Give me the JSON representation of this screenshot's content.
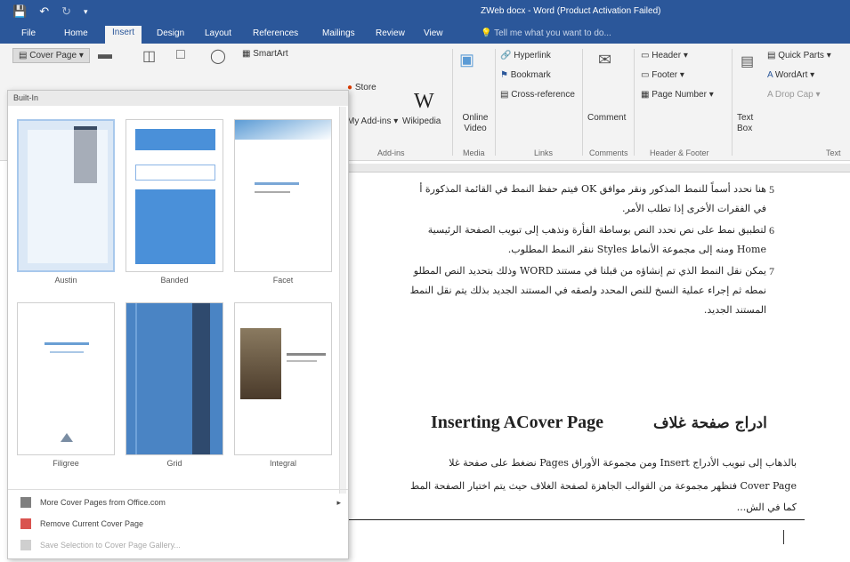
{
  "window": {
    "title": "ZWeb docx - Word (Product Activation Failed)"
  },
  "tabs": [
    {
      "label": "File"
    },
    {
      "label": "Home"
    },
    {
      "label": "Insert"
    },
    {
      "label": "Design"
    },
    {
      "label": "Layout"
    },
    {
      "label": "References"
    },
    {
      "label": "Mailings"
    },
    {
      "label": "Review"
    },
    {
      "label": "View"
    }
  ],
  "tell_me": {
    "placeholder": "Tell me what you want to do..."
  },
  "ribbon": {
    "cover_page": "Cover Page",
    "smartart": "SmartArt",
    "store": "Store",
    "my_addins": "My Add-ins",
    "wikipedia": "Wikipedia",
    "online_video": "Online Video",
    "hyperlink": "Hyperlink",
    "bookmark": "Bookmark",
    "cross_reference": "Cross-reference",
    "comment": "Comment",
    "header": "Header",
    "footer": "Footer",
    "page_number": "Page Number",
    "text_box": "Text Box",
    "quick_parts": "Quick Parts",
    "wordart": "WordArt",
    "drop_cap": "Drop Cap",
    "groups": {
      "addins": "Add-ins",
      "media": "Media",
      "links": "Links",
      "comments": "Comments",
      "header_footer": "Header & Footer",
      "text": "Text"
    }
  },
  "gallery": {
    "header": "Built-In",
    "thumbnails": [
      {
        "caption": "Austin"
      },
      {
        "caption": "Banded"
      },
      {
        "caption": "Facet"
      },
      {
        "caption": "Filigree"
      },
      {
        "caption": "Grid"
      },
      {
        "caption": "Integral"
      }
    ],
    "menu": [
      {
        "label": "More Cover Pages from Office.com",
        "enabled": true
      },
      {
        "label": "Remove Current Cover Page",
        "enabled": true
      },
      {
        "label": "Save Selection to Cover Page Gallery...",
        "enabled": false
      }
    ]
  },
  "document": {
    "items": [
      {
        "num": "5",
        "lines": [
          "هنا نحدد أسماً للنمط المذكور ونقر موافق OK فيتم حفظ النمط في القائمة المذكورة أ",
          "في الفقرات الأخرى إذا تطلب الأمر."
        ]
      },
      {
        "num": "6",
        "lines": [
          "لتطبيق نمط على نص نحدد النص بوساطة الفأرة ونذهب إلى تبويب الصفحة الرئيسية",
          "Home ومنه إلى مجموعة الأنماط Styles ننقر النمط المطلوب."
        ]
      },
      {
        "num": "7",
        "lines": [
          "يمكن نقل النمط الذي تم إنشاؤه من قبلنا في مستند WORD وذلك بتحديد النص المطلو",
          "نمطه ثم إجراء عملية النسخ للنص المحدد ولصقه في المستند الجديد بذلك يتم نقل النمط",
          "المستند الجديد."
        ]
      }
    ],
    "heading_en": "Inserting ACover Page",
    "heading_ar": "ادراج صفحة غلاف",
    "body": [
      "بالذهاب إلى تبويب الأدراج Insert ومن مجموعة الأوراق Pages نضغط على صفحة غلا",
      "Cover Page فتظهر مجموعة من القوالب الجاهزة لصفحة الغلاف حيث يتم اختيار الصفحة المط",
      "كما في الش..."
    ]
  }
}
